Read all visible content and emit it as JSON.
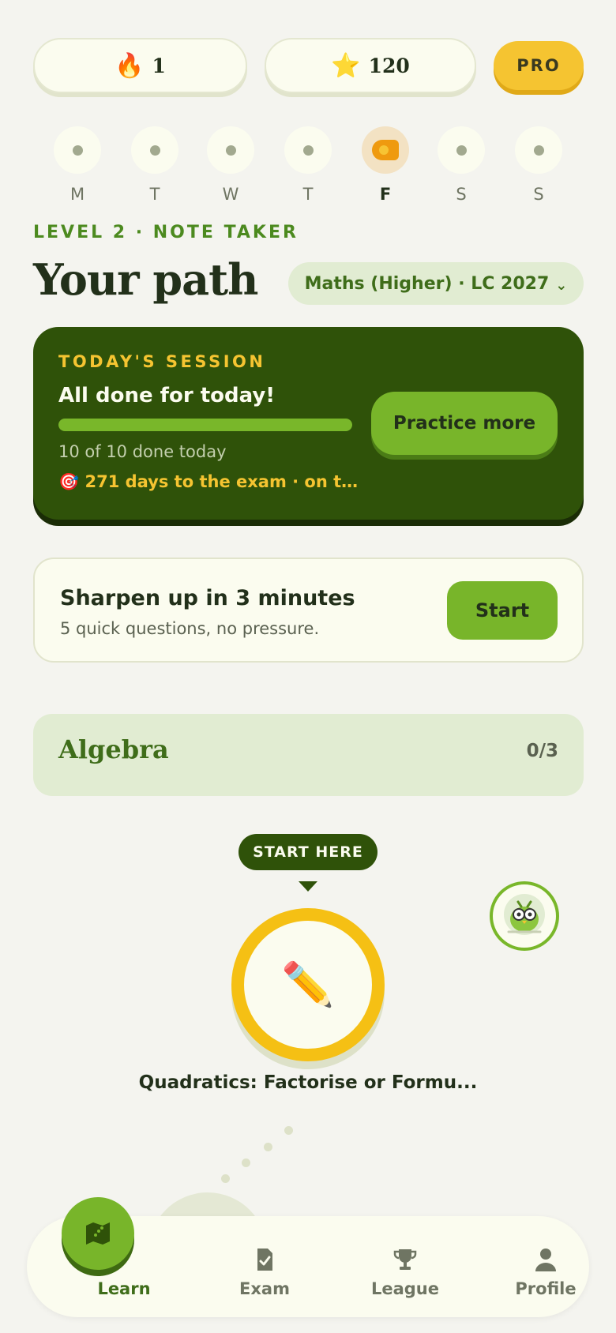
{
  "stats": {
    "streak_icon": "fire-emoji",
    "streak_count": "1",
    "xp_icon": "star-emoji",
    "xp_count": "120",
    "pro_label": "PRO"
  },
  "week": [
    {
      "label": "M",
      "active": false
    },
    {
      "label": "T",
      "active": false
    },
    {
      "label": "W",
      "active": false
    },
    {
      "label": "T",
      "active": false
    },
    {
      "label": "F",
      "active": true
    },
    {
      "label": "S",
      "active": false
    },
    {
      "label": "S",
      "active": false
    }
  ],
  "header": {
    "level": "LEVEL 2 · NOTE TAKER",
    "title": "Your path",
    "course": "Maths (Higher) · LC 2027"
  },
  "session": {
    "kicker": "TODAY'S SESSION",
    "title": "All done for today!",
    "progress": 1.0,
    "count": "10 of 10 done today",
    "exam_icon": "target-emoji",
    "exam": "271 days to the exam · on trac...",
    "button": "Practice more"
  },
  "sharpen": {
    "title": "Sharpen up in 3 minutes",
    "subtitle": "5 quick questions, no pressure.",
    "button": "Start"
  },
  "unit": {
    "name": "Algebra",
    "progress": "0/3"
  },
  "path": {
    "tooltip": "START HERE",
    "lesson_icon": "pencil-emoji",
    "lesson_title": "Quadratics: Factorise or Formu..."
  },
  "nav": {
    "items": [
      {
        "label": "Learn",
        "icon": "map-icon",
        "active": true
      },
      {
        "label": "Exam",
        "icon": "exam-check-icon",
        "active": false
      },
      {
        "label": "League",
        "icon": "trophy-icon",
        "active": false
      },
      {
        "label": "Profile",
        "icon": "person-icon",
        "active": false
      }
    ]
  },
  "colors": {
    "background": "#f4f4ef",
    "dark_green": "#2f5209",
    "accent_green": "#78b52a",
    "yellow": "#f5c431"
  }
}
